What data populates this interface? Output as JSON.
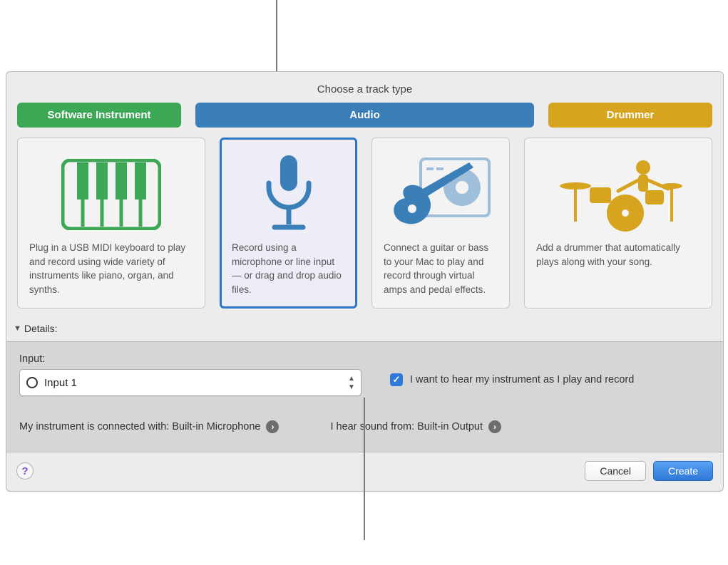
{
  "dialog": {
    "title": "Choose a track type",
    "tabs": {
      "software": "Software Instrument",
      "audio": "Audio",
      "drummer": "Drummer"
    },
    "cards": {
      "software_desc": "Plug in a USB MIDI keyboard to play and record using wide variety of instruments like piano, organ, and synths.",
      "mic_desc": "Record using a microphone or line input — or drag and drop audio files.",
      "guitar_desc": "Connect a guitar or bass to your Mac to play and record through virtual amps and pedal effects.",
      "drummer_desc": "Add a drummer that automatically plays along with your song."
    },
    "details_label": "Details:"
  },
  "details": {
    "input_label": "Input:",
    "input_value": "Input 1",
    "monitor_checkbox": "I want to hear my instrument as I play and record",
    "connected_prefix": "My instrument is connected with: ",
    "connected_value": "Built-in Microphone",
    "output_prefix": "I hear sound from: ",
    "output_value": "Built-in Output"
  },
  "footer": {
    "cancel": "Cancel",
    "create": "Create"
  }
}
